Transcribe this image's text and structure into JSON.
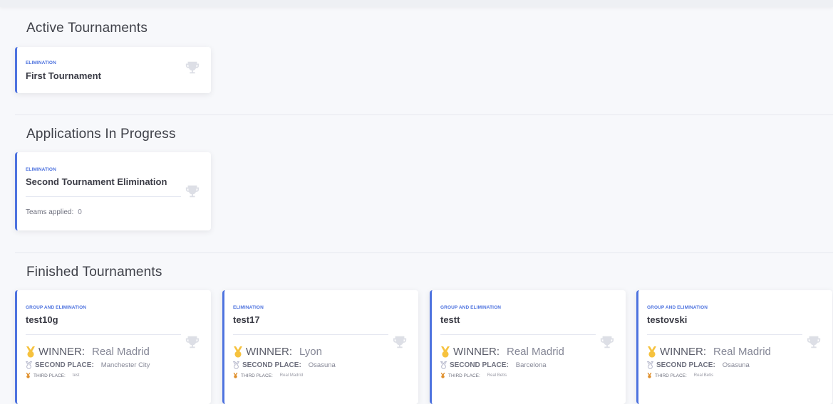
{
  "sections": {
    "active": "Active Tournaments",
    "applications": "Applications In Progress",
    "finished": "Finished Tournaments"
  },
  "active_tournaments": [
    {
      "type": "ELIMINATION",
      "name": "First Tournament"
    }
  ],
  "applications_in_progress": [
    {
      "type": "ELIMINATION",
      "name": "Second Tournament Elimination",
      "teams_applied_label": "Teams applied:",
      "teams_applied": "0"
    }
  ],
  "finished_tournaments": [
    {
      "type": "GROUP AND ELIMINATION",
      "name": "test10g",
      "winner": "Real Madrid",
      "second": "Manchester City",
      "third": "test"
    },
    {
      "type": "ELIMINATION",
      "name": "test17",
      "winner": "Lyon",
      "second": "Osasuna",
      "third": "Real Madrid"
    },
    {
      "type": "GROUP AND ELIMINATION",
      "name": "testt",
      "winner": "Real Madrid",
      "second": "Barcelona",
      "third": "Real Betis"
    },
    {
      "type": "GROUP AND ELIMINATION",
      "name": "testovski",
      "winner": "Real Madrid",
      "second": "Osasuna",
      "third": "Real Betis"
    }
  ],
  "labels": {
    "winner": "WINNER:",
    "second": "SECOND PLACE:",
    "third": "THIRD PLACE:"
  },
  "colors": {
    "accent": "#4e73df",
    "gold": "#f6c23e",
    "silver": "#b7b9cc",
    "bronze": "#e0902d",
    "trophy": "#dddfe6"
  }
}
